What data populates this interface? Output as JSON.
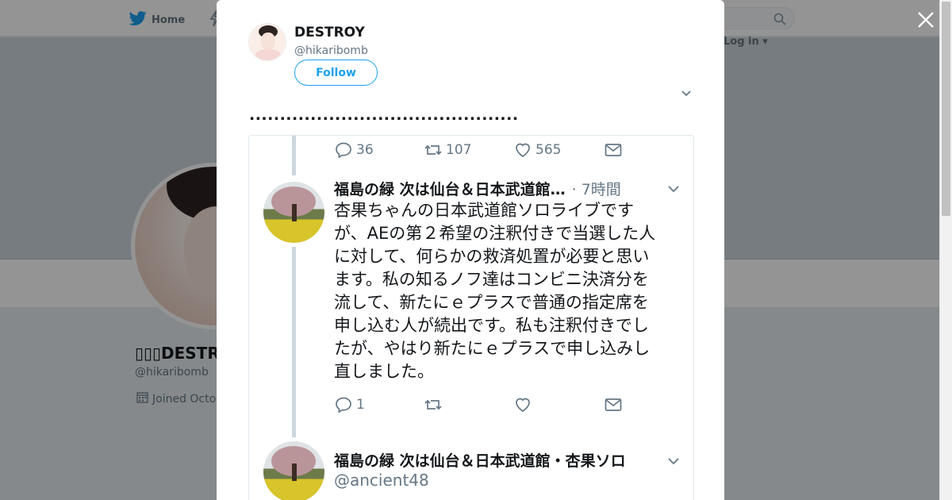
{
  "background": {
    "nav_home": "Home",
    "login": "Log in",
    "profile_name": "▯▯▯DESTR",
    "profile_handle": "@hikaribomb",
    "joined": "Joined Octo"
  },
  "modal": {
    "name": "DESTROY",
    "handle": "@hikaribomb",
    "follow_label": "Follow",
    "dots": "............................................"
  },
  "thread": {
    "prev_actions": {
      "replies": "36",
      "retweets": "107",
      "likes": "565"
    },
    "tweet1": {
      "author": "福島の緑 次は仙台＆日本武道館…",
      "time": "· 7時間",
      "lines": [
        "杏果ちゃんの日本武道館ソロライブです",
        "が、AEの第２希望の注釈付きで当選した人",
        "に対して、何らかの救済処置が必要と思い",
        "ます。私の知るノフ達はコンビニ決済分を",
        "流して、新たにｅプラスで普通の指定席を",
        "申し込む人が続出です。私も注釈付きでし",
        "たが、やはり新たにｅプラスで申し込みし",
        "直しました。"
      ],
      "actions": {
        "replies": "1",
        "retweets": "",
        "likes": ""
      }
    },
    "tweet2": {
      "author": "福島の緑 次は仙台＆日本武道館・杏果ソロ",
      "handle": "@ancient48"
    }
  },
  "colors": {
    "accent": "#1da1f2",
    "text": "#14171a",
    "muted": "#657786",
    "overlay": "rgba(0,0,0,0.42)"
  }
}
